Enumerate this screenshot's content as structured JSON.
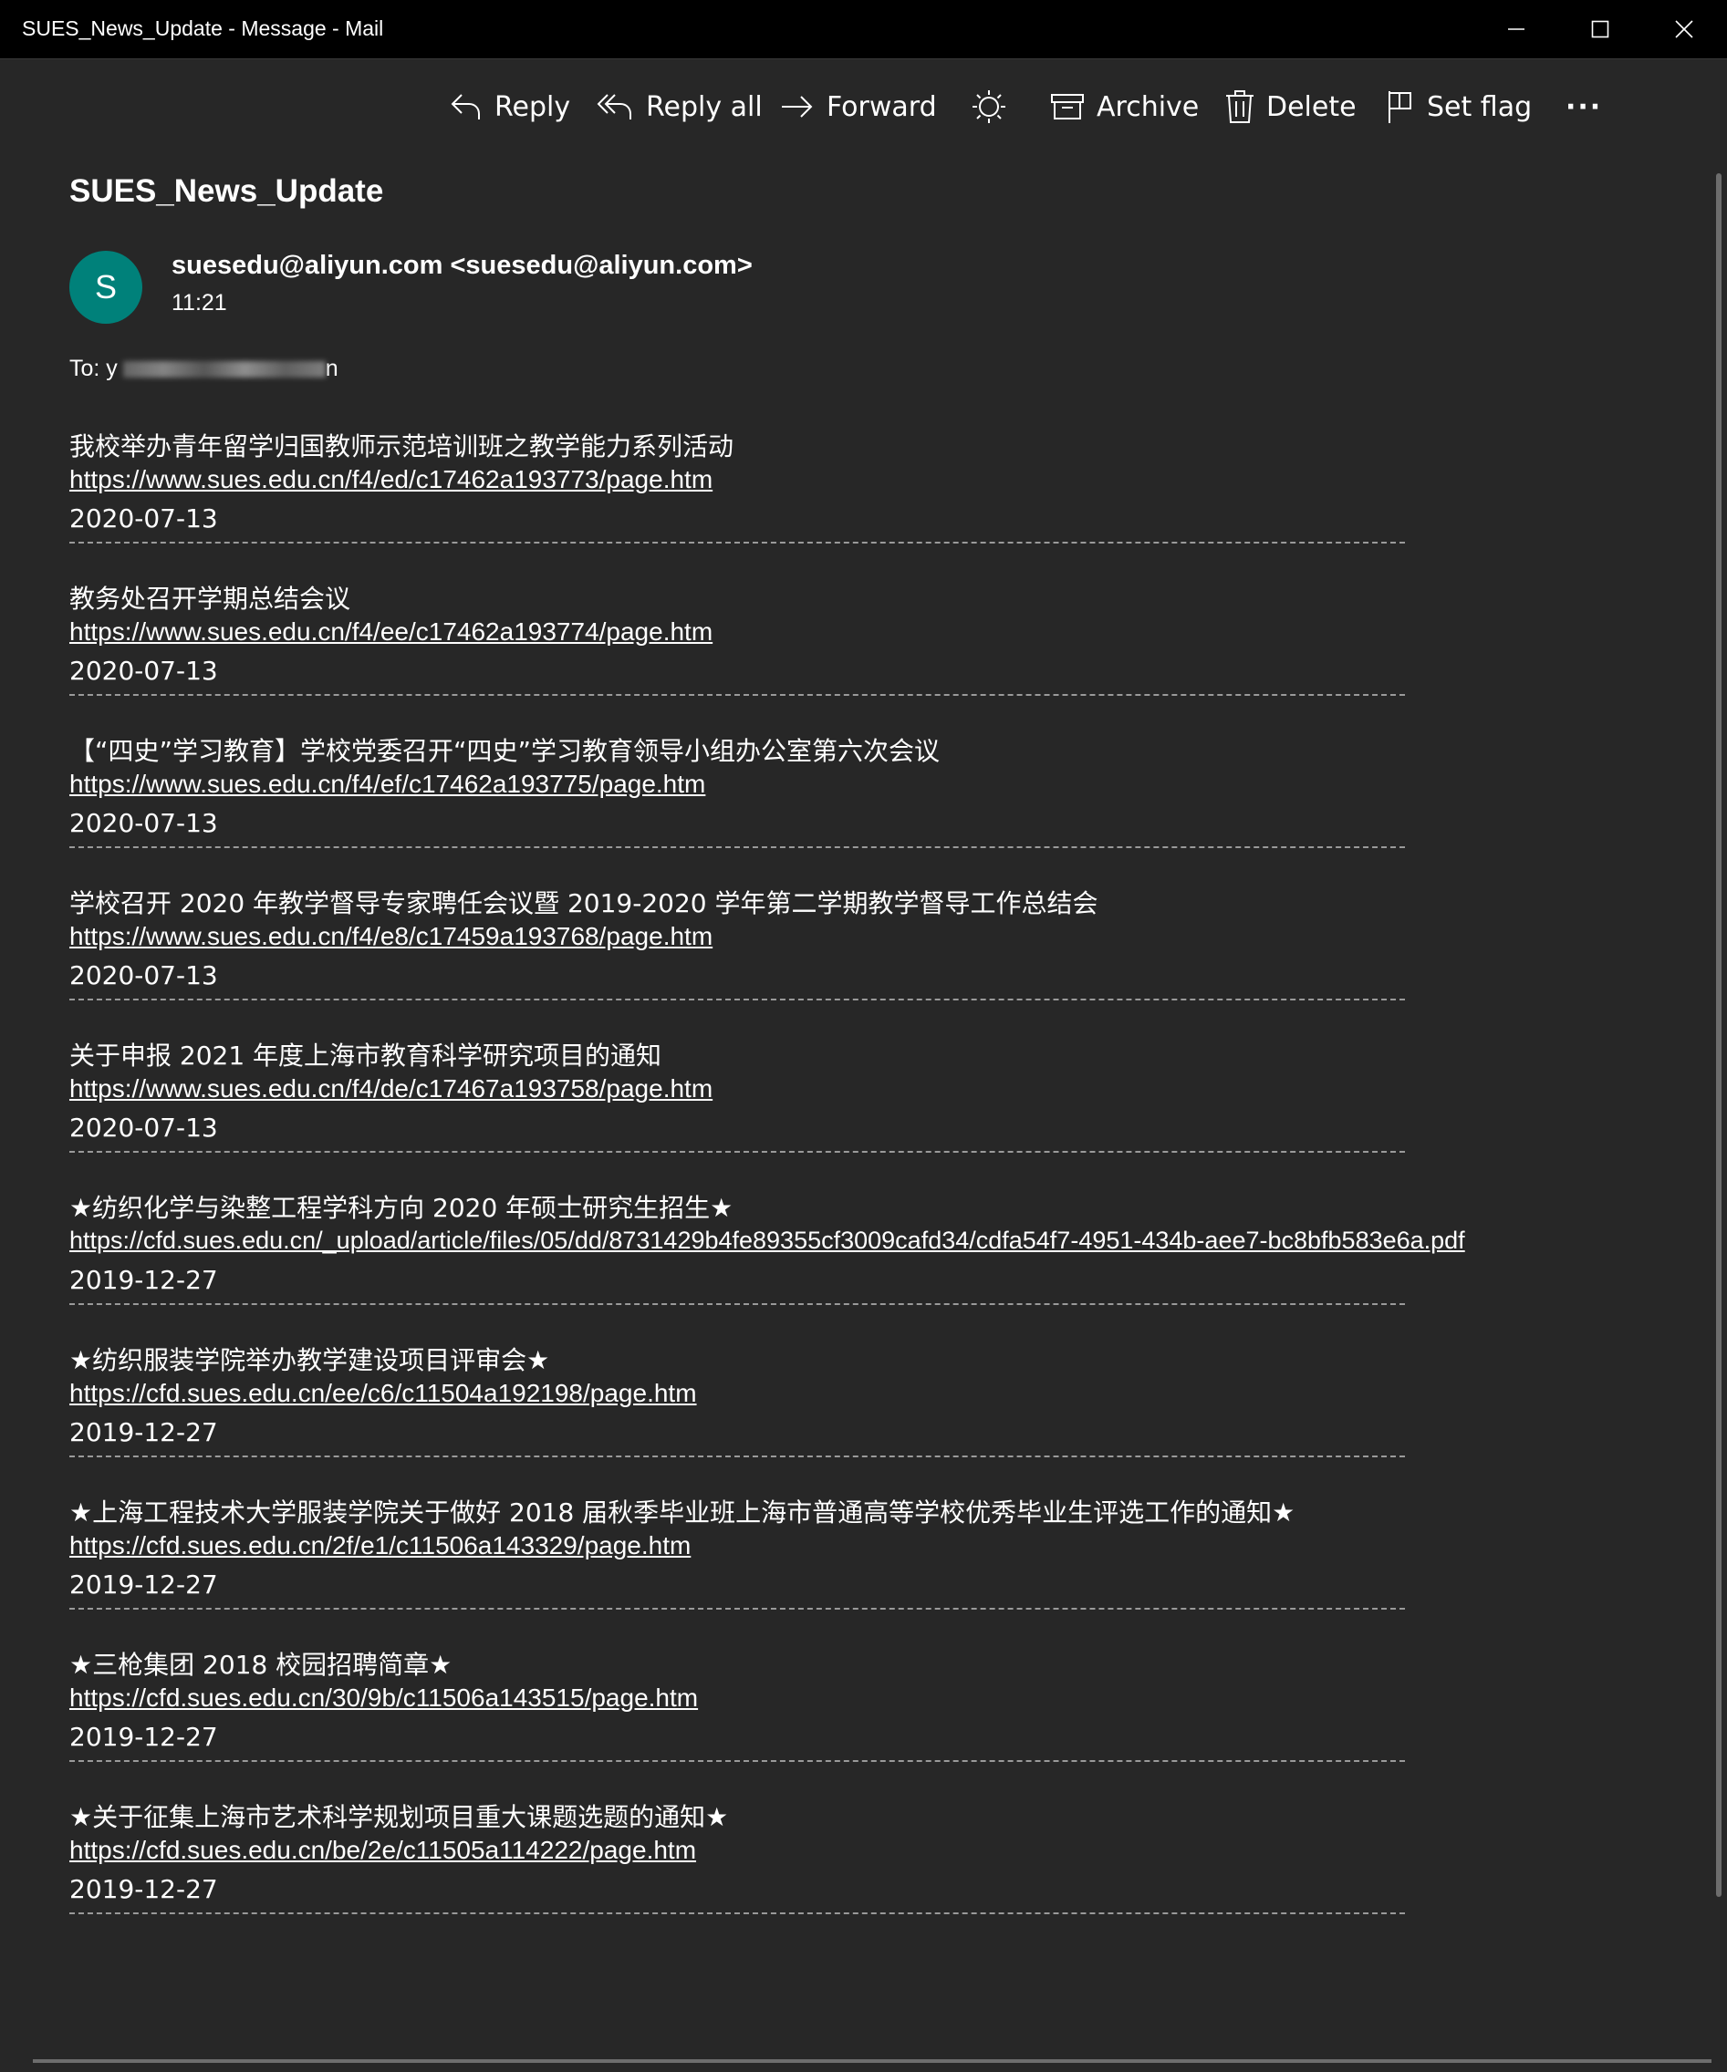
{
  "window": {
    "title": "SUES_News_Update - Message - Mail"
  },
  "toolbar": {
    "reply": "Reply",
    "reply_all": "Reply all",
    "forward": "Forward",
    "archive": "Archive",
    "delete": "Delete",
    "set_flag": "Set flag",
    "more": "···"
  },
  "message": {
    "subject": "SUES_News_Update",
    "avatar_letter": "S",
    "sender": "suesedu@aliyun.com <suesedu@aliyun.com>",
    "time": "11:21",
    "to_label": "To: y",
    "to_suffix": "n",
    "accent_color": "#00817a"
  },
  "items": [
    {
      "title": "我校举办青年留学归国教师示范培训班之教学能力系列活动",
      "url": "https://www.sues.edu.cn/f4/ed/c17462a193773/page.htm",
      "date": "2020-07-13"
    },
    {
      "title": "教务处召开学期总结会议",
      "url": "https://www.sues.edu.cn/f4/ee/c17462a193774/page.htm",
      "date": "2020-07-13"
    },
    {
      "title": "【“四史”学习教育】学校党委召开“四史”学习教育领导小组办公室第六次会议",
      "url": "https://www.sues.edu.cn/f4/ef/c17462a193775/page.htm",
      "date": "2020-07-13"
    },
    {
      "title": "学校召开 2020 年教学督导专家聘任会议暨 2019-2020 学年第二学期教学督导工作总结会",
      "url": "https://www.sues.edu.cn/f4/e8/c17459a193768/page.htm",
      "date": "2020-07-13"
    },
    {
      "title": "关于申报 2021 年度上海市教育科学研究项目的通知",
      "url": "https://www.sues.edu.cn/f4/de/c17467a193758/page.htm",
      "date": "2020-07-13"
    },
    {
      "title": "★纺织化学与染整工程学科方向 2020 年硕士研究生招生★",
      "url": "https://cfd.sues.edu.cn/_upload/article/files/05/dd/8731429b4fe89355cf3009cafd34/cdfa54f7-4951-434b-aee7-bc8bfb583e6a.pdf",
      "date": "2019-12-27"
    },
    {
      "title": "★纺织服装学院举办教学建设项目评审会★",
      "url": "https://cfd.sues.edu.cn/ee/c6/c11504a192198/page.htm",
      "date": "2019-12-27"
    },
    {
      "title": "★上海工程技术大学服装学院关于做好 2018 届秋季毕业班上海市普通高等学校优秀毕业生评选工作的通知★",
      "url": "https://cfd.sues.edu.cn/2f/e1/c11506a143329/page.htm",
      "date": "2019-12-27"
    },
    {
      "title": "★三枪集团 2018 校园招聘简章★",
      "url": "https://cfd.sues.edu.cn/30/9b/c11506a143515/page.htm",
      "date": "2019-12-27"
    },
    {
      "title": "★关于征集上海市艺术科学规划项目重大课题选题的通知★",
      "url": "https://cfd.sues.edu.cn/be/2e/c11505a114222/page.htm",
      "date": "2019-12-27"
    }
  ]
}
